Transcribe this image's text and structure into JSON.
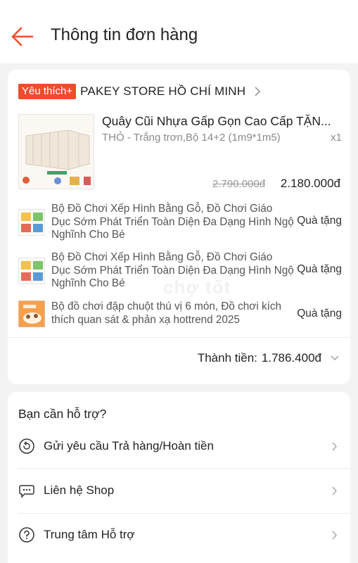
{
  "header": {
    "title": "Thông tin đơn hàng"
  },
  "shop": {
    "badge": "Yêu thích+",
    "name": "PAKEY STORE HỒ CHÍ MINH"
  },
  "main_product": {
    "title": "Quây Cũi Nhựa Gấp Gọn Cao Cấp TẶN...",
    "variant": "THỎ - Trắng trơn,Bộ 14+2 (1m9*1m5)",
    "quantity": "x1",
    "original_price": "2.790.000đ",
    "price": "2.180.000đ"
  },
  "gifts": [
    {
      "name": "Bộ Đồ Chơi Xếp Hình Bằng Gỗ, Đồ Chơi Giáo Dục Sớm Phát Triển Toàn Diện Đa Dạng Hình Ngộ Nghĩnh Cho Bé",
      "tag": "Quà tặng"
    },
    {
      "name": "Bộ Đồ Chơi Xếp Hình Bằng Gỗ, Đồ Chơi Giáo Dục Sớm Phát Triển Toàn Diện Đa Dạng Hình Ngộ Nghĩnh Cho Bé",
      "tag": "Quà tặng"
    },
    {
      "name": "Bộ đồ chơi đập chuột thú vị 6 món, Đồ chơi kích thích quan sát & phản xạ hottrend 2025",
      "tag": "Quà tặng"
    }
  ],
  "total": {
    "label": "Thành tiền:",
    "value": "1.786.400đ"
  },
  "support": {
    "title": "Bạn cần hỗ trợ?",
    "items": [
      {
        "label": "Gửi yêu cầu Trả hàng/Hoàn tiền",
        "icon": "return-icon"
      },
      {
        "label": "Liên hệ Shop",
        "icon": "chat-icon"
      },
      {
        "label": "Trung tâm Hỗ trợ",
        "icon": "help-icon"
      }
    ]
  },
  "colors": {
    "accent": "#ee4d2d",
    "background": "#f3f3f3",
    "muted_text": "#8a8a8a"
  }
}
